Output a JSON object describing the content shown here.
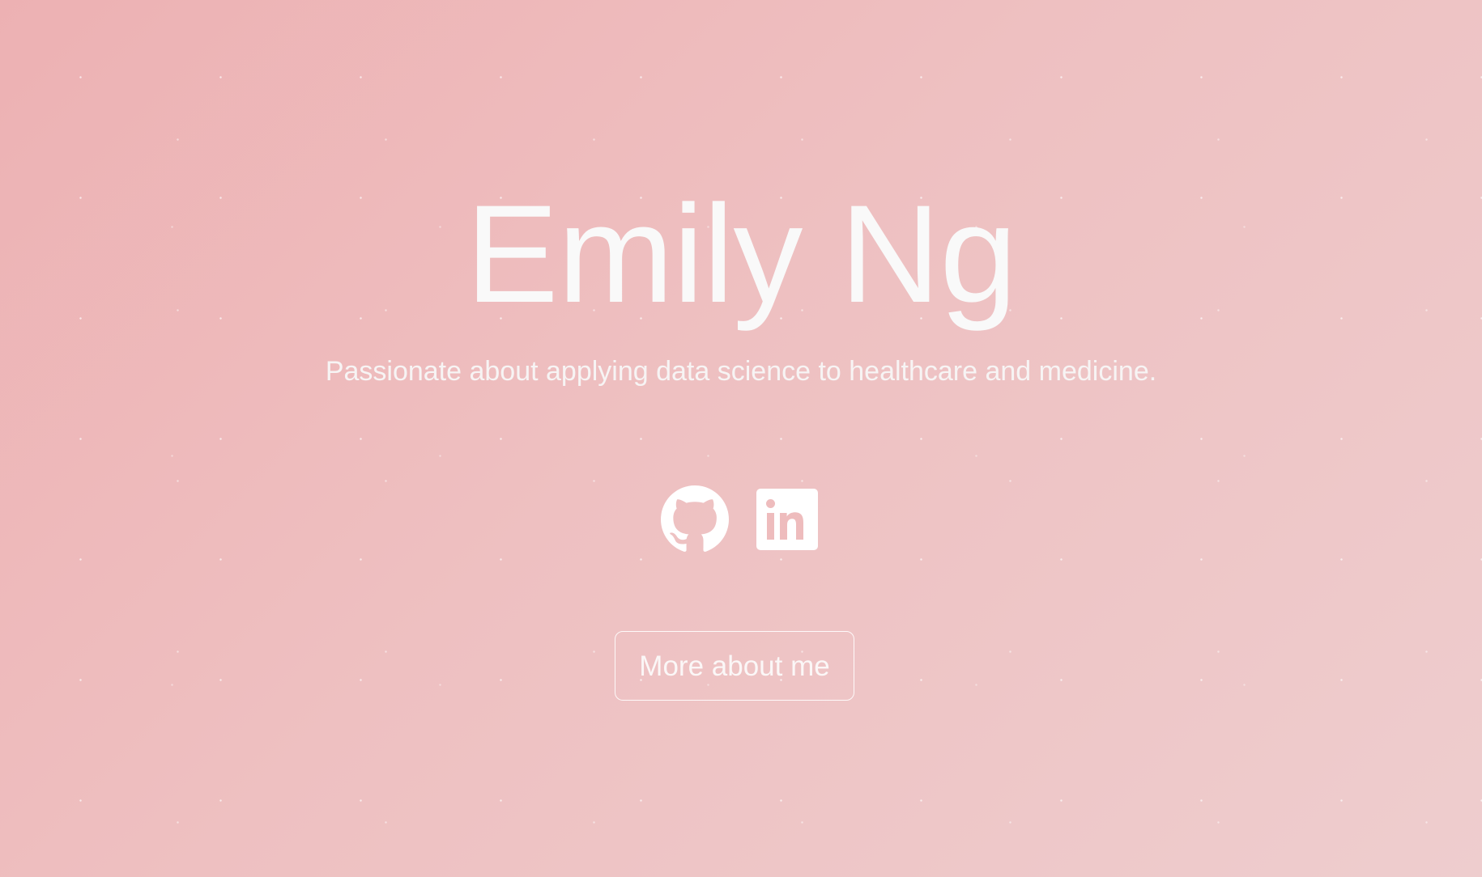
{
  "hero": {
    "name": "Emily Ng",
    "tagline": "Passionate about applying data science to healthcare and medicine."
  },
  "socials": [
    {
      "icon": "github-icon",
      "label": "GitHub"
    },
    {
      "icon": "linkedin-icon",
      "label": "LinkedIn"
    }
  ],
  "cta": {
    "label": "More about me"
  },
  "colors": {
    "background_start": "#edb1b3",
    "background_end": "#eecdce",
    "text": "#f9f9f9"
  }
}
